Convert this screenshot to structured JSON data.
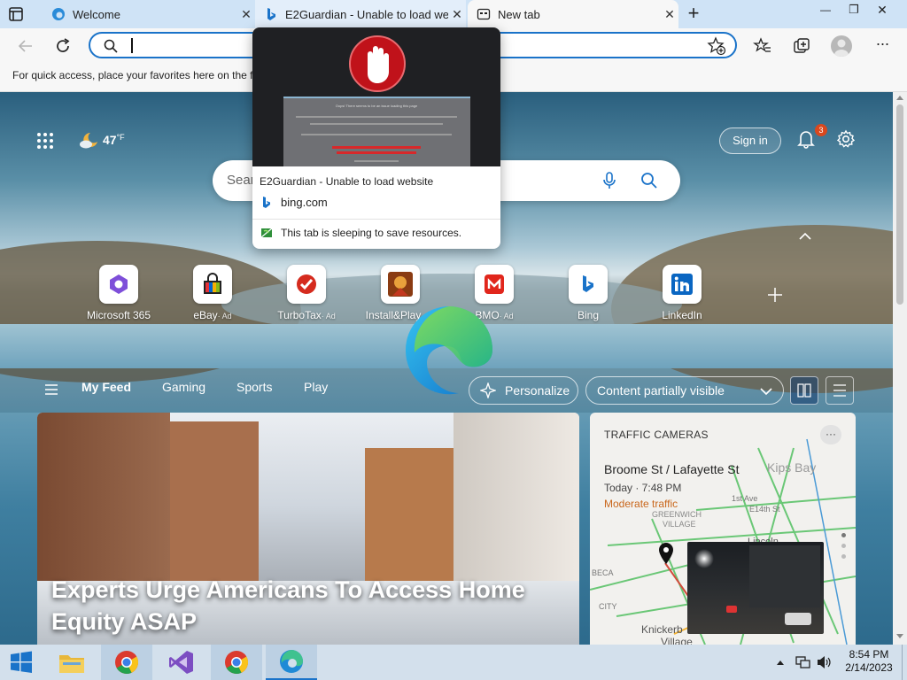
{
  "browser": {
    "tabs": [
      {
        "label": "Welcome",
        "close": "✕"
      },
      {
        "label": "E2Guardian - Unable to load website",
        "close": "✕"
      },
      {
        "label": "New tab",
        "close": "✕"
      }
    ],
    "new_tab": "+",
    "window_controls": {
      "minimize": "—",
      "restore": "❐",
      "close": "✕"
    },
    "address_value": "",
    "favorites_hint": "For quick access, place your favorites here on the f"
  },
  "hover_card": {
    "title": "E2Guardian - Unable to load website",
    "domain": "bing.com",
    "status": "This tab is sleeping to save resources.",
    "thumb_heading": "Oops! There seems to be an issue loading this page"
  },
  "ntp": {
    "weather_temp": "47",
    "weather_unit": "°F",
    "search_placeholder": "Sear",
    "sign_in": "Sign in",
    "notification_count": "3",
    "quick_links": [
      {
        "label": "Microsoft 365",
        "ad": ""
      },
      {
        "label": "eBay",
        "ad": "· Ad"
      },
      {
        "label": "TurboTax",
        "ad": "· Ad"
      },
      {
        "label": "Install&Play",
        "ad": "· Ad"
      },
      {
        "label": "BMO",
        "ad": "· Ad"
      },
      {
        "label": "Bing",
        "ad": ""
      },
      {
        "label": "LinkedIn",
        "ad": ""
      }
    ],
    "feed_nav": {
      "my_feed": "My Feed",
      "gaming": "Gaming",
      "sports": "Sports",
      "play": "Play",
      "more": "...",
      "personalize": "Personalize",
      "content_visibility": "Content partially visible"
    },
    "hero_headline": "Experts Urge Americans To Access Home Equity ASAP",
    "traffic": {
      "heading": "TRAFFIC CAMERAS",
      "more": "···",
      "location": "Broome St / Lafayette St",
      "time": "Today · 7:48 PM",
      "status": "Moderate traffic",
      "map_labels": [
        "Kips Bay",
        "GREENWICH",
        "VILLAGE",
        "1st Ave",
        "E14th St",
        "Knickerb",
        "Village",
        "BECA",
        "CITY",
        "Lincoln"
      ]
    }
  },
  "taskbar": {
    "time": "8:54 PM",
    "date": "2/14/2023"
  },
  "colors": {
    "accent": "#1a73c9",
    "traffic_orange": "#c9671c",
    "tabstrip": "#cfe3f6"
  }
}
